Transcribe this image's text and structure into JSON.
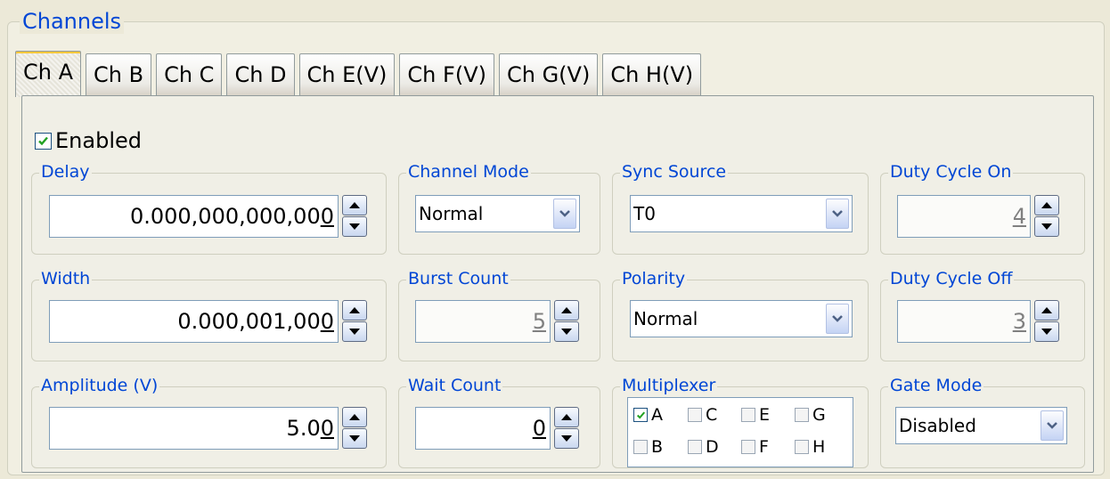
{
  "channels": {
    "title": "Channels",
    "tabs": [
      "Ch A",
      "Ch B",
      "Ch C",
      "Ch D",
      "Ch E(V)",
      "Ch F(V)",
      "Ch G(V)",
      "Ch H(V)"
    ],
    "active_tab": "Ch A"
  },
  "enabled": {
    "label": "Enabled",
    "checked": true
  },
  "delay": {
    "title": "Delay",
    "value_main": "0.000,000,000,00",
    "value_last": "0"
  },
  "width": {
    "title": "Width",
    "value_main": "0.000,001,00",
    "value_last": "0"
  },
  "amplitude": {
    "title": "Amplitude (V)",
    "value_main": "5.0",
    "value_last": "0"
  },
  "channel_mode": {
    "title": "Channel Mode",
    "value": "Normal"
  },
  "burst_count": {
    "title": "Burst Count",
    "value": "5"
  },
  "wait_count": {
    "title": "Wait Count",
    "value": "0"
  },
  "sync_source": {
    "title": "Sync Source",
    "value": "T0"
  },
  "polarity": {
    "title": "Polarity",
    "value": "Normal"
  },
  "multiplexer": {
    "title": "Multiplexer",
    "items": [
      {
        "label": "A",
        "checked": true
      },
      {
        "label": "C",
        "checked": false
      },
      {
        "label": "E",
        "checked": false
      },
      {
        "label": "G",
        "checked": false
      },
      {
        "label": "B",
        "checked": false
      },
      {
        "label": "D",
        "checked": false
      },
      {
        "label": "F",
        "checked": false
      },
      {
        "label": "H",
        "checked": false
      }
    ]
  },
  "duty_cycle_on": {
    "title": "Duty Cycle On",
    "value": "4"
  },
  "duty_cycle_off": {
    "title": "Duty Cycle Off",
    "value": "3"
  },
  "gate_mode": {
    "title": "Gate Mode",
    "value": "Disabled"
  },
  "colors": {
    "label_blue": "#0046d5",
    "check_green": "#21a121",
    "background": "#ece9d8"
  }
}
